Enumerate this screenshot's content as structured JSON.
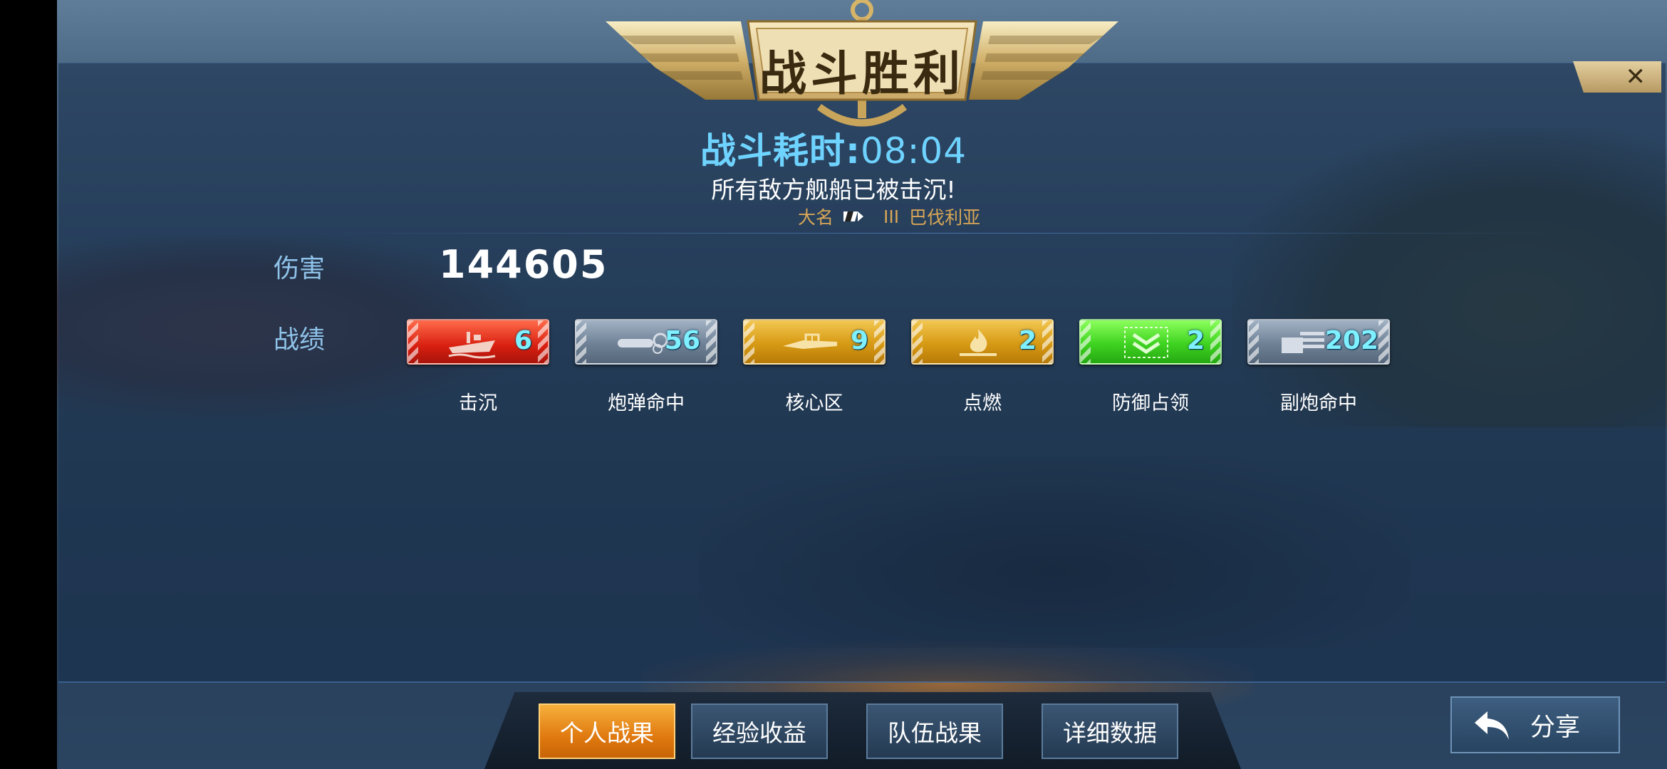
{
  "header": {
    "banner_title": "战斗胜利",
    "close_glyph": "✕",
    "duration_label": "战斗耗时: ",
    "duration_value": "08:04",
    "result_message": "所有敌方舰船已被击沉!",
    "player": {
      "name": "大名",
      "tier": "III",
      "ship": "巴伐利亚"
    }
  },
  "stats": {
    "damage_label": "伤害",
    "damage_value": "144605",
    "record_label": "战绩",
    "badges": [
      {
        "caption": "击沉",
        "value": "6",
        "icon": "sinking-ship-icon",
        "color": "#d81f10"
      },
      {
        "caption": "炮弹命中",
        "value": "56",
        "icon": "shell-hit-icon",
        "color": "#6f8196"
      },
      {
        "caption": "核心区",
        "value": "9",
        "icon": "citadel-icon",
        "color": "#d79a14"
      },
      {
        "caption": "点燃",
        "value": "2",
        "icon": "fire-icon",
        "color": "#d79a14"
      },
      {
        "caption": "防御占领",
        "value": "2",
        "icon": "capture-defense-icon",
        "color": "#3fd321"
      },
      {
        "caption": "副炮命中",
        "value": "202",
        "icon": "secondary-battery-icon",
        "color": "#6f8196"
      }
    ]
  },
  "tabs": [
    {
      "label": "个人战果",
      "active": true
    },
    {
      "label": "经验收益",
      "active": false
    },
    {
      "label": "队伍战果",
      "active": false
    },
    {
      "label": "详细数据",
      "active": false
    }
  ],
  "share": {
    "label": "分享",
    "icon": "back-arrow-icon"
  }
}
